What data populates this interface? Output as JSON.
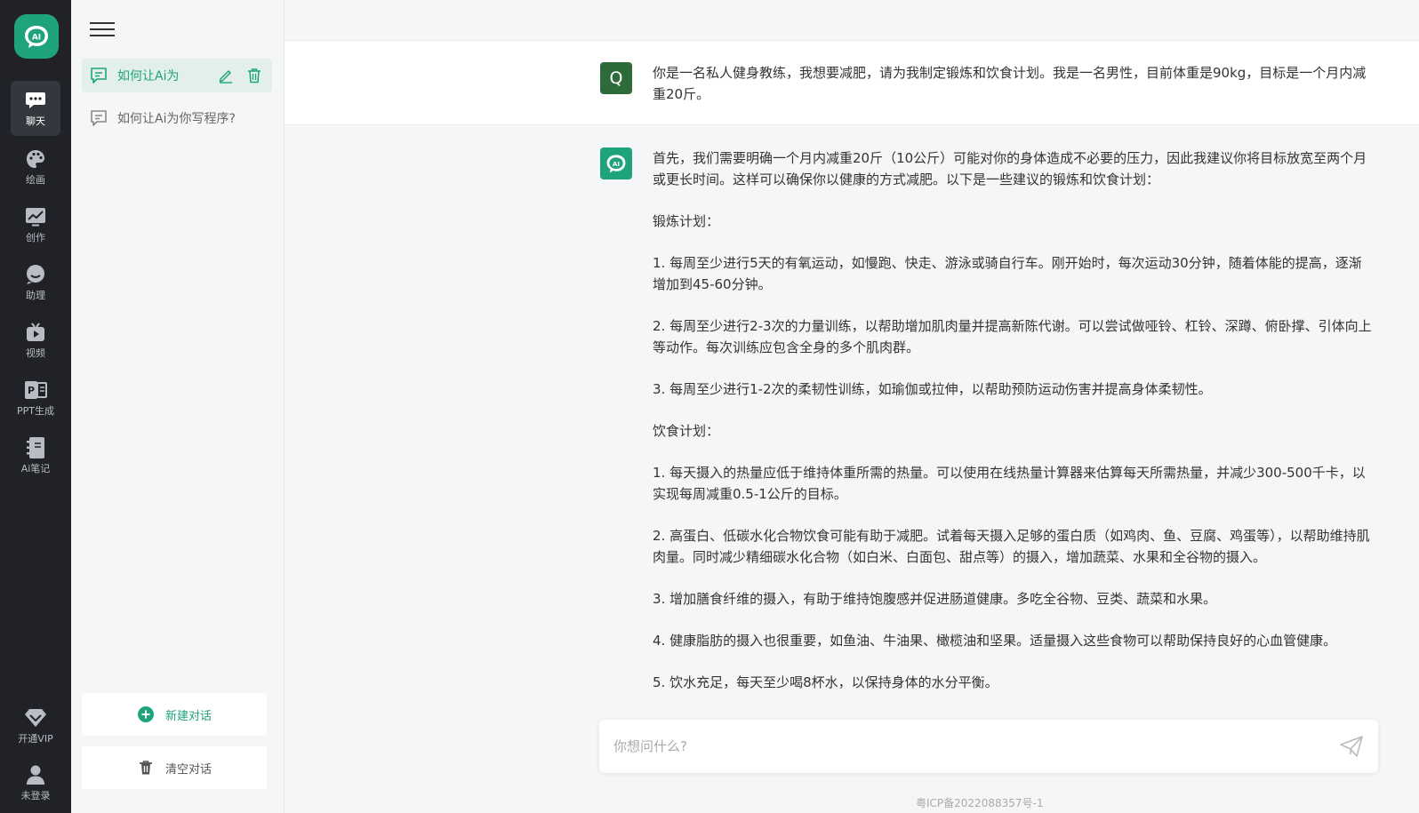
{
  "rail": {
    "items": [
      {
        "label": "聊天",
        "icon": "chat-icon"
      },
      {
        "label": "绘画",
        "icon": "palette-icon"
      },
      {
        "label": "创作",
        "icon": "chart-icon"
      },
      {
        "label": "助理",
        "icon": "assistant-icon"
      },
      {
        "label": "视频",
        "icon": "tv-icon"
      },
      {
        "label": "PPT生成",
        "icon": "ppt-icon"
      },
      {
        "label": "Ai笔记",
        "icon": "notebook-icon"
      }
    ],
    "vip_label": "开通VIP",
    "login_label": "未登录"
  },
  "history": {
    "conversations": [
      {
        "title": "如何让Ai为"
      },
      {
        "title": "如何让Ai为你写程序?"
      }
    ],
    "new_chat_label": "新建对话",
    "clear_label": "清空对话"
  },
  "chat": {
    "user_avatar": "Q",
    "user_message": "你是一名私人健身教练，我想要减肥，请为我制定锻炼和饮食计划。我是一名男性，目前体重是90kg，目标是一个月内减重20斤。",
    "ai_paragraphs": [
      "首先，我们需要明确一个月内减重20斤（10公斤）可能对你的身体造成不必要的压力，因此我建议你将目标放宽至两个月或更长时间。这样可以确保你以健康的方式减肥。以下是一些建议的锻炼和饮食计划：",
      "锻炼计划：",
      "1. 每周至少进行5天的有氧运动，如慢跑、快走、游泳或骑自行车。刚开始时，每次运动30分钟，随着体能的提高，逐渐增加到45-60分钟。",
      "2. 每周至少进行2-3次的力量训练，以帮助增加肌肉量并提高新陈代谢。可以尝试做哑铃、杠铃、深蹲、俯卧撑、引体向上等动作。每次训练应包含全身的多个肌肉群。",
      "3. 每周至少进行1-2次的柔韧性训练，如瑜伽或拉伸，以帮助预防运动伤害并提高身体柔韧性。",
      "饮食计划：",
      "1. 每天摄入的热量应低于维持体重所需的热量。可以使用在线热量计算器来估算每天所需热量，并减少300-500千卡，以实现每周减重0.5-1公斤的目标。",
      "2. 高蛋白、低碳水化合物饮食可能有助于减肥。试着每天摄入足够的蛋白质（如鸡肉、鱼、豆腐、鸡蛋等），以帮助维持肌肉量。同时减少精细碳水化合物（如白米、白面包、甜点等）的摄入，增加蔬菜、水果和全谷物的摄入。",
      "3. 增加膳食纤维的摄入，有助于维持饱腹感并促进肠道健康。多吃全谷物、豆类、蔬菜和水果。",
      "4. 健康脂肪的摄入也很重要，如鱼油、牛油果、橄榄油和坚果。适量摄入这些食物可以帮助保持良好的心血管健康。",
      "5. 饮水充足，每天至少喝8杯水，以保持身体的水分平衡。"
    ],
    "input_placeholder": "你想问什么?",
    "icp": "粤ICP备2022088357号-1"
  },
  "colors": {
    "accent": "#1fa37c",
    "rail_bg": "#202227",
    "panel_bg": "#f5f6f7"
  }
}
